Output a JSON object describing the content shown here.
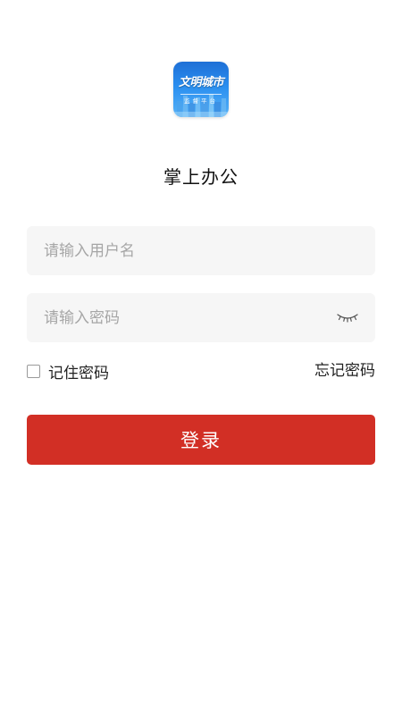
{
  "logo": {
    "title": "文明城市",
    "subtitle": "监督平台",
    "icon": "city-skyline-logo-icon"
  },
  "app": {
    "name": "掌上办公"
  },
  "username": {
    "placeholder": "请输入用户名",
    "value": ""
  },
  "password": {
    "placeholder": "请输入密码",
    "value": "",
    "toggle_icon": "eye-closed-icon"
  },
  "remember": {
    "label": "记住密码",
    "checked": false
  },
  "forgot": {
    "label": "忘记密码"
  },
  "login": {
    "label": "登录"
  },
  "colors": {
    "primary": "#d22f25",
    "field_bg": "#f6f6f6",
    "placeholder": "#a6a6a6",
    "logo_blue": "#1e6fd6"
  }
}
